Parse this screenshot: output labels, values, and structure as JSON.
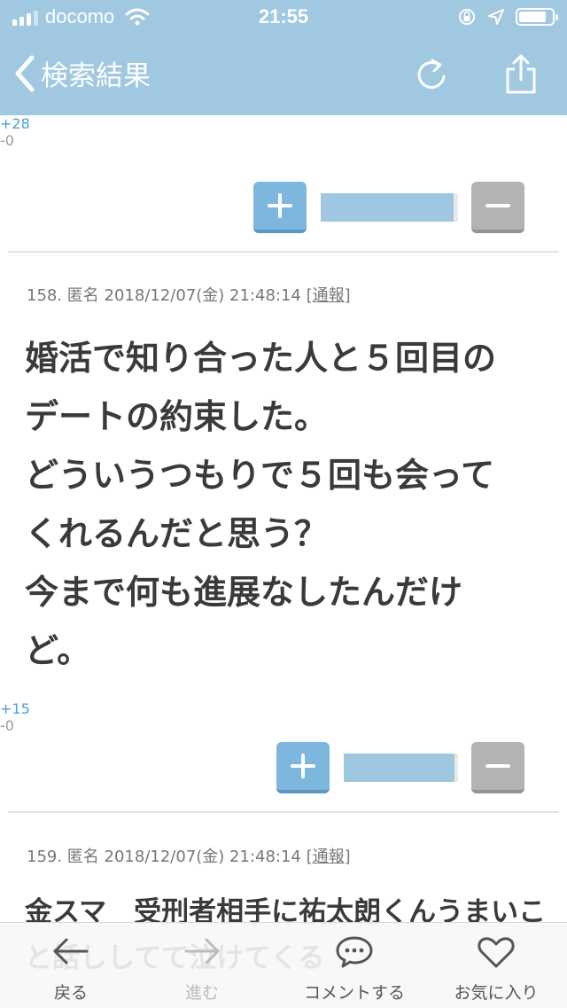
{
  "status_bar": {
    "carrier": "docomo",
    "time": "21:55",
    "battery_level": 0.85
  },
  "nav": {
    "back_label": "検索結果"
  },
  "posts": [
    {
      "plus": "+28",
      "minus": "-0",
      "ratio": 1.0
    },
    {
      "meta_prefix": "158. 匿名 2018/12/07(金) 21:48:14 ",
      "report": "[通報]",
      "body": "婚活で知り合った人と５回目の\nデートの約束した。\nどういうつもりで５回も会って\nくれるんだと思う？\n今まで何も進展なしたんだけ\nど。",
      "plus": "+15",
      "minus": "-0",
      "ratio": 1.0
    },
    {
      "meta_prefix": "159. 匿名 2018/12/07(金) 21:48:14 ",
      "report": "[通報]",
      "body": "金スマ　受刑者相手に祐太朗くんうまいこ\nと話ししてて泣けてくる"
    }
  ],
  "tabbar": {
    "back": "戻る",
    "forward": "進む",
    "comment": "コメントする",
    "favorite": "お気に入り"
  },
  "colors": {
    "accent": "#a0c8e0",
    "plus": "#7eb7dd",
    "minus": "#b3b3b3",
    "plus_text": "#4a9fd6"
  }
}
